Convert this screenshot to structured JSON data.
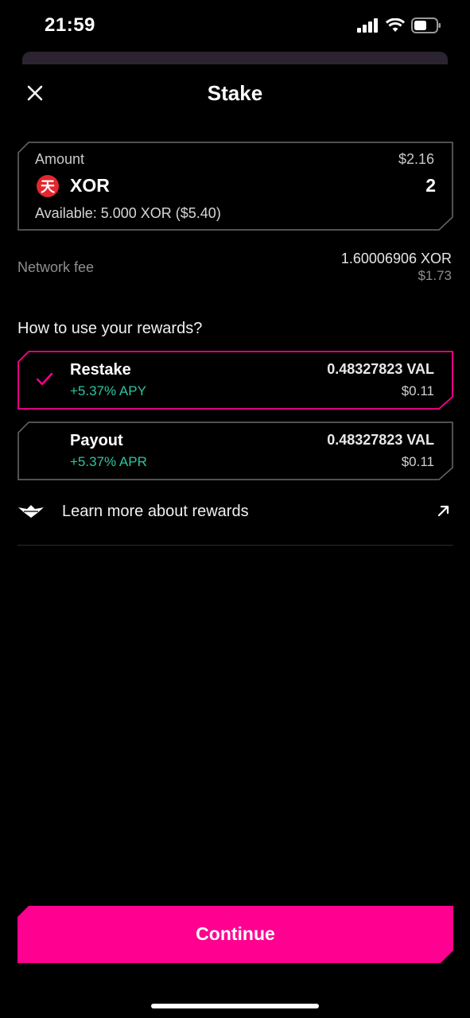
{
  "status_bar": {
    "time": "21:59",
    "icons": [
      "signal-icon",
      "wifi-icon",
      "battery-icon"
    ]
  },
  "header": {
    "title": "Stake",
    "close_icon": "close-icon"
  },
  "amount": {
    "label": "Amount",
    "usd_value": "$2.16",
    "token_symbol": "XOR",
    "token_icon_glyph": "天",
    "value": "2",
    "available": "Available: 5.000 XOR ($5.40)"
  },
  "network_fee": {
    "label": "Network fee",
    "value": "1.60006906 XOR",
    "usd": "$1.73"
  },
  "rewards": {
    "question": "How to use your rewards?",
    "options": [
      {
        "name": "Restake",
        "rate": "+5.37% APY",
        "amount": "0.48327823 VAL",
        "usd": "$0.11",
        "selected": true
      },
      {
        "name": "Payout",
        "rate": "+5.37% APR",
        "amount": "0.48327823 VAL",
        "usd": "$0.11",
        "selected": false
      }
    ]
  },
  "learn_more": {
    "label": "Learn more about rewards"
  },
  "footer": {
    "continue_label": "Continue"
  },
  "colors": {
    "accent": "#ff0090",
    "positive": "#2ec4a0",
    "card_border": "#5a5a5a",
    "token_red": "#e3262f"
  }
}
